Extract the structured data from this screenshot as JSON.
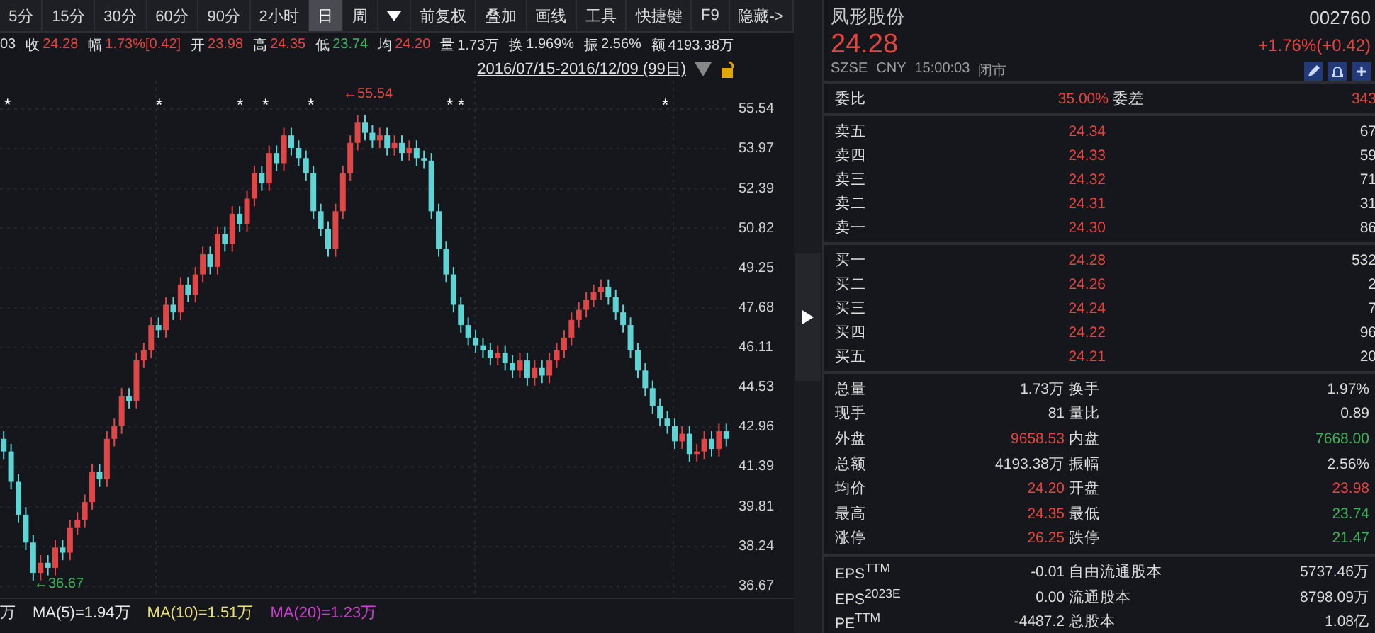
{
  "toolbar": {
    "periods": [
      {
        "label": "5分",
        "selected": false
      },
      {
        "label": "15分",
        "selected": false
      },
      {
        "label": "30分",
        "selected": false
      },
      {
        "label": "60分",
        "selected": false
      },
      {
        "label": "90分",
        "selected": false
      },
      {
        "label": "2小时",
        "selected": false
      },
      {
        "label": "日",
        "selected": true
      },
      {
        "label": "周",
        "selected": false
      }
    ],
    "tools": [
      "前复权",
      "叠加",
      "画线",
      "工具",
      "快捷键",
      "F9",
      "隐藏->"
    ]
  },
  "quote_line": {
    "lead": "03",
    "items": [
      {
        "label": "收",
        "value": "24.28",
        "color": "#e5453f"
      },
      {
        "label": "幅",
        "value": "1.73%[0.42]",
        "color": "#e5453f"
      },
      {
        "label": "开",
        "value": "23.98",
        "color": "#e5453f"
      },
      {
        "label": "高",
        "value": "24.35",
        "color": "#e5453f"
      },
      {
        "label": "低",
        "value": "23.74",
        "color": "#3fb35c"
      },
      {
        "label": "均",
        "value": "24.20",
        "color": "#e5453f"
      },
      {
        "label": "量",
        "value": "1.73万",
        "color": "#dcdcdc"
      },
      {
        "label": "换",
        "value": "1.969%",
        "color": "#dcdcdc"
      },
      {
        "label": "振",
        "value": "2.56%",
        "color": "#dcdcdc"
      },
      {
        "label": "额",
        "value": "4193.38万",
        "color": "#dcdcdc"
      }
    ]
  },
  "date_range": "2016/07/15-2016/12/09 (99日)",
  "chart": {
    "marks": [
      "*",
      "*",
      "*",
      "*",
      "*",
      "*",
      "*",
      "*"
    ],
    "high_label": "←55.54",
    "low_label": "←36.67",
    "chart_data": {
      "type": "candlestick",
      "grid": true,
      "categories": [
        null,
        null,
        null,
        null,
        null,
        null,
        null,
        null,
        null,
        null,
        null,
        null,
        null,
        null,
        null,
        null,
        null,
        null,
        null,
        null,
        null,
        null,
        null,
        null,
        null,
        null,
        null,
        null,
        null,
        null,
        null,
        null,
        null,
        null,
        null,
        null,
        null,
        null,
        null,
        null,
        null,
        null,
        null,
        null,
        null,
        null,
        null,
        null,
        null,
        null,
        null,
        null,
        null,
        null,
        null,
        null,
        null,
        null,
        null,
        null,
        null,
        null,
        null,
        null,
        null,
        null,
        null,
        null,
        null,
        null,
        null,
        null,
        null,
        null,
        null,
        null,
        null,
        null,
        null,
        null,
        null,
        null,
        null,
        null,
        null,
        null,
        null,
        null,
        null,
        null,
        null,
        null,
        null,
        null,
        null,
        null,
        null,
        null,
        null
      ],
      "ylim": [
        36.67,
        55.54
      ],
      "yticks": [
        55.54,
        53.97,
        52.39,
        50.82,
        49.25,
        47.68,
        46.11,
        44.53,
        42.96,
        41.39,
        39.81,
        38.24,
        36.67
      ],
      "ohlc": [
        [
          42.5,
          42.8,
          41.7,
          42.0
        ],
        [
          42.0,
          42.3,
          40.5,
          40.8
        ],
        [
          40.8,
          41.1,
          39.2,
          39.5
        ],
        [
          39.5,
          39.8,
          38.1,
          38.4
        ],
        [
          38.4,
          38.7,
          36.9,
          37.2
        ],
        [
          37.2,
          37.9,
          36.9,
          37.6
        ],
        [
          37.6,
          37.9,
          37.1,
          37.4
        ],
        [
          37.4,
          38.5,
          37.1,
          38.2
        ],
        [
          38.2,
          38.5,
          37.7,
          38.0
        ],
        [
          38.0,
          39.3,
          37.7,
          39.0
        ],
        [
          39.0,
          39.6,
          38.7,
          39.3
        ],
        [
          39.3,
          40.3,
          39.0,
          40.0
        ],
        [
          40.0,
          41.5,
          39.7,
          41.2
        ],
        [
          41.2,
          41.5,
          40.6,
          40.9
        ],
        [
          40.9,
          42.8,
          40.6,
          42.5
        ],
        [
          42.5,
          43.3,
          42.2,
          43.0
        ],
        [
          43.0,
          44.5,
          42.7,
          44.2
        ],
        [
          44.2,
          44.5,
          43.7,
          44.0
        ],
        [
          44.0,
          45.9,
          43.7,
          45.6
        ],
        [
          45.6,
          46.3,
          45.3,
          46.0
        ],
        [
          46.0,
          47.3,
          45.7,
          47.0
        ],
        [
          47.0,
          47.3,
          46.5,
          46.8
        ],
        [
          46.8,
          48.1,
          46.5,
          47.8
        ],
        [
          47.8,
          48.1,
          47.2,
          47.5
        ],
        [
          47.5,
          48.9,
          47.2,
          48.6
        ],
        [
          48.6,
          48.9,
          47.9,
          48.2
        ],
        [
          48.2,
          49.3,
          47.9,
          49.0
        ],
        [
          49.0,
          50.1,
          48.7,
          49.8
        ],
        [
          49.8,
          50.1,
          49.0,
          49.3
        ],
        [
          49.3,
          50.9,
          49.0,
          50.6
        ],
        [
          50.6,
          50.9,
          49.9,
          50.2
        ],
        [
          50.2,
          51.7,
          49.9,
          51.4
        ],
        [
          51.4,
          51.7,
          50.7,
          51.0
        ],
        [
          51.0,
          52.3,
          50.7,
          52.0
        ],
        [
          52.0,
          53.3,
          51.7,
          53.0
        ],
        [
          53.0,
          53.3,
          52.3,
          52.6
        ],
        [
          52.6,
          54.1,
          52.3,
          53.8
        ],
        [
          53.8,
          54.1,
          53.1,
          53.4
        ],
        [
          53.4,
          54.8,
          53.1,
          54.5
        ],
        [
          54.5,
          54.8,
          53.7,
          54.0
        ],
        [
          54.0,
          54.3,
          53.3,
          53.6
        ],
        [
          53.6,
          53.9,
          52.7,
          53.0
        ],
        [
          53.0,
          53.3,
          51.2,
          51.5
        ],
        [
          51.5,
          51.8,
          50.5,
          50.8
        ],
        [
          50.8,
          51.1,
          49.7,
          50.0
        ],
        [
          50.0,
          51.8,
          49.7,
          51.5
        ],
        [
          51.5,
          53.3,
          51.2,
          53.0
        ],
        [
          53.0,
          54.5,
          52.7,
          54.2
        ],
        [
          54.2,
          55.3,
          53.9,
          55.0
        ],
        [
          55.0,
          55.3,
          54.3,
          54.6
        ],
        [
          54.6,
          54.9,
          54.0,
          54.3
        ],
        [
          54.3,
          54.8,
          54.0,
          54.5
        ],
        [
          54.5,
          54.8,
          53.7,
          54.0
        ],
        [
          54.0,
          54.5,
          53.7,
          54.2
        ],
        [
          54.2,
          54.5,
          53.5,
          53.8
        ],
        [
          53.8,
          54.3,
          53.5,
          54.0
        ],
        [
          54.0,
          54.3,
          53.3,
          53.6
        ],
        [
          53.6,
          53.9,
          53.2,
          53.5
        ],
        [
          53.5,
          53.8,
          51.2,
          51.5
        ],
        [
          51.5,
          51.8,
          49.7,
          50.0
        ],
        [
          50.0,
          50.3,
          48.7,
          49.0
        ],
        [
          49.0,
          49.3,
          47.5,
          47.8
        ],
        [
          47.8,
          48.1,
          46.7,
          47.0
        ],
        [
          47.0,
          47.3,
          46.2,
          46.5
        ],
        [
          46.5,
          46.8,
          45.9,
          46.2
        ],
        [
          46.2,
          46.5,
          45.7,
          46.0
        ],
        [
          46.0,
          46.3,
          45.4,
          45.7
        ],
        [
          45.7,
          46.2,
          45.4,
          45.9
        ],
        [
          45.9,
          46.2,
          45.2,
          45.5
        ],
        [
          45.5,
          45.8,
          44.9,
          45.2
        ],
        [
          45.2,
          45.9,
          44.9,
          45.6
        ],
        [
          45.6,
          45.9,
          44.6,
          44.9
        ],
        [
          44.9,
          45.6,
          44.6,
          45.3
        ],
        [
          45.3,
          45.6,
          44.7,
          45.0
        ],
        [
          45.0,
          45.9,
          44.7,
          45.6
        ],
        [
          45.6,
          46.3,
          45.3,
          46.0
        ],
        [
          46.0,
          46.8,
          45.7,
          46.5
        ],
        [
          46.5,
          47.5,
          46.2,
          47.2
        ],
        [
          47.2,
          47.9,
          46.9,
          47.6
        ],
        [
          47.6,
          48.3,
          47.3,
          48.0
        ],
        [
          48.0,
          48.6,
          47.7,
          48.3
        ],
        [
          48.3,
          48.8,
          48.0,
          48.5
        ],
        [
          48.5,
          48.8,
          47.8,
          48.1
        ],
        [
          48.1,
          48.4,
          47.2,
          47.5
        ],
        [
          47.5,
          47.8,
          46.7,
          47.0
        ],
        [
          47.0,
          47.3,
          45.7,
          46.0
        ],
        [
          46.0,
          46.3,
          44.9,
          45.2
        ],
        [
          45.2,
          45.5,
          44.2,
          44.5
        ],
        [
          44.5,
          44.8,
          43.5,
          43.8
        ],
        [
          43.8,
          44.1,
          43.0,
          43.3
        ],
        [
          43.3,
          43.6,
          42.7,
          43.0
        ],
        [
          43.0,
          43.3,
          42.1,
          42.4
        ],
        [
          42.4,
          43.0,
          42.1,
          42.7
        ],
        [
          42.7,
          43.0,
          41.6,
          41.9
        ],
        [
          41.9,
          42.3,
          41.6,
          42.0
        ],
        [
          42.0,
          42.8,
          41.7,
          42.5
        ],
        [
          42.5,
          42.8,
          41.8,
          42.1
        ],
        [
          42.1,
          43.1,
          41.8,
          42.8
        ],
        [
          42.8,
          43.1,
          42.2,
          42.5
        ]
      ]
    }
  },
  "legend": {
    "lead": "万",
    "items": [
      {
        "text": "MA(5)=1.94万",
        "color": "#e6e6e6"
      },
      {
        "text": "MA(10)=1.51万",
        "color": "#e8e070"
      },
      {
        "text": "MA(20)=1.23万",
        "color": "#d040d0"
      }
    ]
  },
  "stock": {
    "name": "凤形股份",
    "code": "002760",
    "price": "24.28",
    "change": "+1.76%(+0.42)",
    "exchange": "SZSE",
    "currency": "CNY",
    "time": "15:00:03",
    "status": "闭市"
  },
  "order_ratio": {
    "label": "委比",
    "value": "35.00%",
    "label2": "委差",
    "value2": "343"
  },
  "asks": [
    {
      "label": "卖五",
      "price": "24.34",
      "volume": "67"
    },
    {
      "label": "卖四",
      "price": "24.33",
      "volume": "59"
    },
    {
      "label": "卖三",
      "price": "24.32",
      "volume": "71"
    },
    {
      "label": "卖二",
      "price": "24.31",
      "volume": "31"
    },
    {
      "label": "卖一",
      "price": "24.30",
      "volume": "86"
    }
  ],
  "bids": [
    {
      "label": "买一",
      "price": "24.28",
      "volume": "532"
    },
    {
      "label": "买二",
      "price": "24.26",
      "volume": "2"
    },
    {
      "label": "买三",
      "price": "24.24",
      "volume": "7"
    },
    {
      "label": "买四",
      "price": "24.22",
      "volume": "96"
    },
    {
      "label": "买五",
      "price": "24.21",
      "volume": "20"
    }
  ],
  "stats": [
    {
      "left": {
        "label": "总量",
        "value": "1.73万",
        "color": "#dcdcdc"
      },
      "right": {
        "label": "换手",
        "value": "1.97%",
        "color": "#dcdcdc"
      }
    },
    {
      "left": {
        "label": "现手",
        "value": "81",
        "color": "#dcdcdc"
      },
      "right": {
        "label": "量比",
        "value": "0.89",
        "color": "#dcdcdc"
      }
    },
    {
      "left": {
        "label": "外盘",
        "value": "9658.53",
        "color": "#e5453f"
      },
      "right": {
        "label": "内盘",
        "value": "7668.00",
        "color": "#3fb35c"
      }
    },
    {
      "left": {
        "label": "总额",
        "value": "4193.38万",
        "color": "#dcdcdc"
      },
      "right": {
        "label": "振幅",
        "value": "2.56%",
        "color": "#dcdcdc"
      }
    },
    {
      "left": {
        "label": "均价",
        "value": "24.20",
        "color": "#e5453f"
      },
      "right": {
        "label": "开盘",
        "value": "23.98",
        "color": "#e5453f"
      }
    },
    {
      "left": {
        "label": "最高",
        "value": "24.35",
        "color": "#e5453f"
      },
      "right": {
        "label": "最低",
        "value": "23.74",
        "color": "#3fb35c"
      }
    },
    {
      "left": {
        "label": "涨停",
        "value": "26.25",
        "color": "#e5453f"
      },
      "right": {
        "label": "跌停",
        "value": "21.47",
        "color": "#3fb35c"
      }
    }
  ],
  "fundamentals": [
    {
      "label": "EPS$^{TTM}$",
      "value": "-0.01",
      "label2": "自由流通股本",
      "value2": "5737.46万"
    },
    {
      "label": "EPS$^{2023E}$",
      "value": "0.00",
      "label2": "流通股本",
      "value2": "8798.09万"
    },
    {
      "label": "PE$^{TTM}$",
      "value": "-4487.2",
      "label2": "总股本",
      "value2": "1.08亿"
    }
  ]
}
